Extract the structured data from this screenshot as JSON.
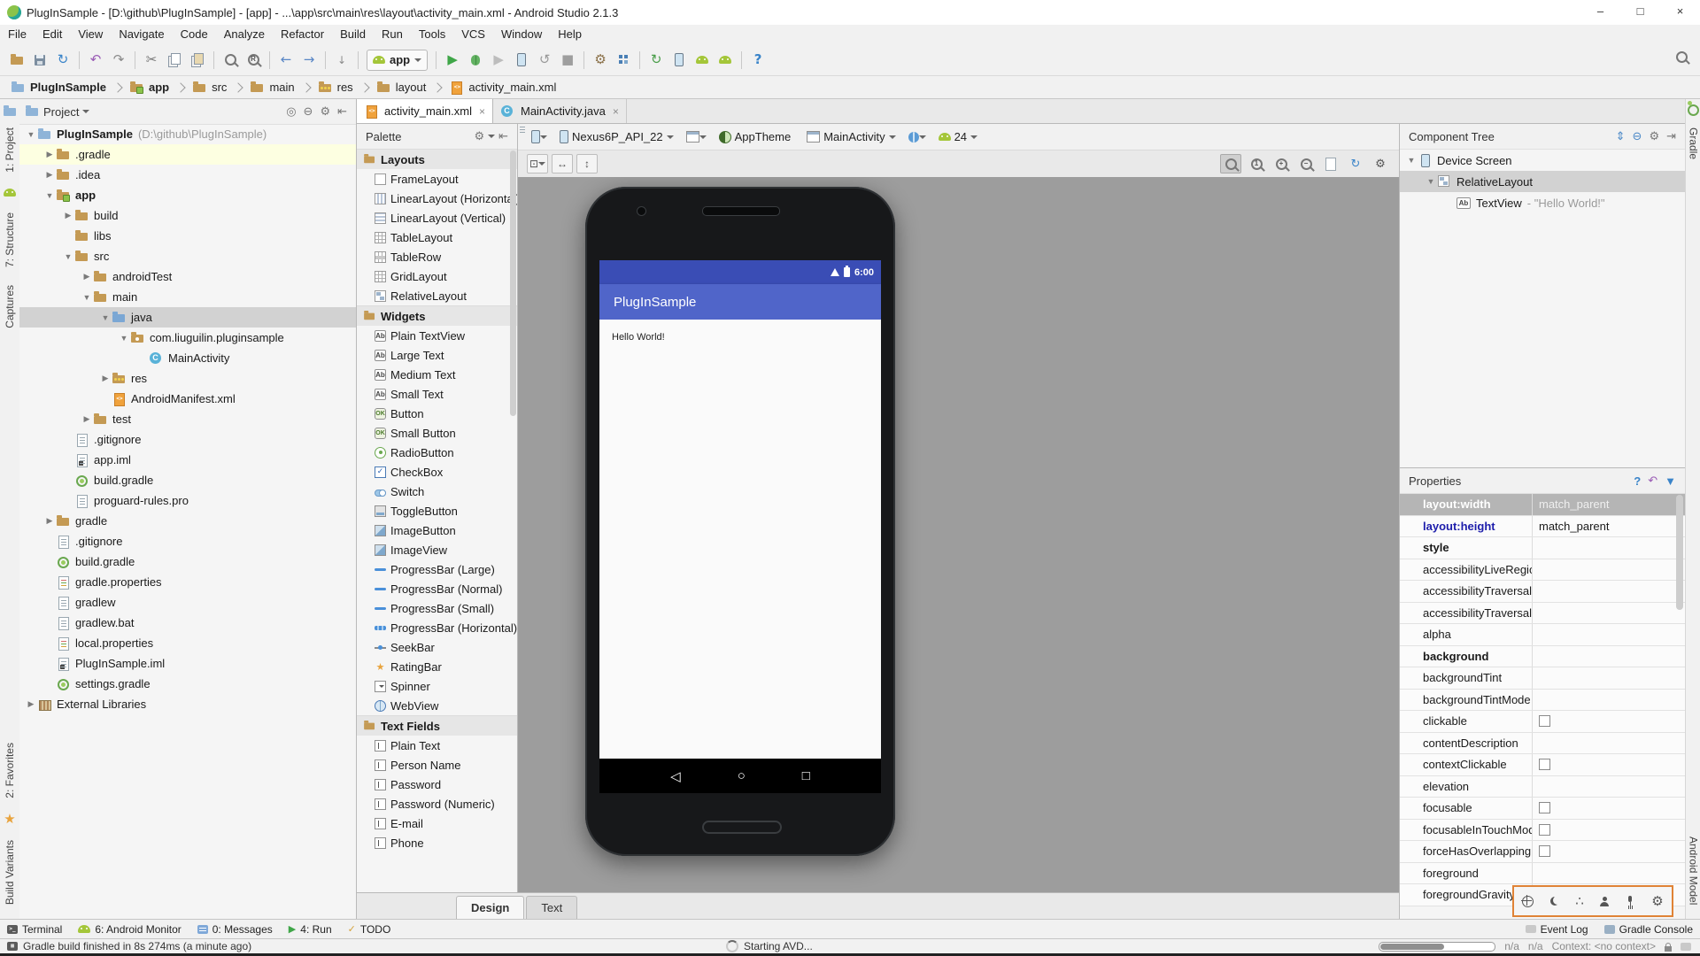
{
  "window": {
    "title": "PlugInSample - [D:\\github\\PlugInSample] - [app] - ...\\app\\src\\main\\res\\layout\\activity_main.xml - Android Studio 2.1.3",
    "controls": [
      "minimize",
      "maximize",
      "close"
    ]
  },
  "menubar": {
    "items": [
      "File",
      "Edit",
      "View",
      "Navigate",
      "Code",
      "Analyze",
      "Refactor",
      "Build",
      "Run",
      "Tools",
      "VCS",
      "Window",
      "Help"
    ]
  },
  "toolbar": {
    "run_config": "app",
    "groups": [
      [
        "open",
        "save",
        "sync"
      ],
      [
        "undo",
        "redo"
      ],
      [
        "cut",
        "copy",
        "paste"
      ],
      [
        "find",
        "replace"
      ],
      [
        "back",
        "forward"
      ],
      [
        "line-ops"
      ],
      [
        "run-config"
      ],
      [
        "run",
        "debug",
        "coverage",
        "attach-debugger",
        "restart",
        "stop"
      ],
      [
        "settings",
        "structure"
      ],
      [
        "gradle-sync",
        "avd-manager",
        "sdk-manager",
        "device-monitor"
      ],
      [
        "help"
      ]
    ]
  },
  "breadcrumbs": {
    "items": [
      {
        "label": "PlugInSample",
        "icon": "project",
        "bold": true
      },
      {
        "label": "app",
        "icon": "module",
        "bold": true
      },
      {
        "label": "src",
        "icon": "folder"
      },
      {
        "label": "main",
        "icon": "folder"
      },
      {
        "label": "res",
        "icon": "res"
      },
      {
        "label": "layout",
        "icon": "folder"
      },
      {
        "label": "activity_main.xml",
        "icon": "xml"
      }
    ]
  },
  "left_strip": {
    "top": [
      "1: Project",
      "7: Structure",
      "Captures"
    ],
    "bottom": [
      "2: Favorites",
      "Build Variants"
    ]
  },
  "right_strip": {
    "top": [
      "Gradle"
    ],
    "bottom": [
      "Android Model"
    ]
  },
  "project": {
    "title": "Project",
    "tree": [
      {
        "d": 0,
        "icon": "project",
        "label": "PlugInSample",
        "note": "(D:\\github\\PlugInSample)",
        "bold": true,
        "arrow": "down"
      },
      {
        "d": 1,
        "icon": "folder",
        "label": ".gradle",
        "arrow": "right",
        "highlight": true
      },
      {
        "d": 1,
        "icon": "folder",
        "label": ".idea",
        "arrow": "right"
      },
      {
        "d": 1,
        "icon": "module",
        "label": "app",
        "bold": true,
        "arrow": "down"
      },
      {
        "d": 2,
        "icon": "folder",
        "label": "build",
        "arrow": "right"
      },
      {
        "d": 2,
        "icon": "folder",
        "label": "libs"
      },
      {
        "d": 2,
        "icon": "folder",
        "label": "src",
        "arrow": "down"
      },
      {
        "d": 3,
        "icon": "folder",
        "label": "androidTest",
        "arrow": "right"
      },
      {
        "d": 3,
        "icon": "folder",
        "label": "main",
        "arrow": "down"
      },
      {
        "d": 4,
        "icon": "folder-blue",
        "label": "java",
        "arrow": "down",
        "selected": true
      },
      {
        "d": 5,
        "icon": "package",
        "label": "com.liuguilin.pluginsample",
        "arrow": "down"
      },
      {
        "d": 6,
        "icon": "class",
        "label": "MainActivity"
      },
      {
        "d": 4,
        "icon": "res",
        "label": "res",
        "arrow": "right"
      },
      {
        "d": 4,
        "icon": "xml",
        "label": "AndroidManifest.xml"
      },
      {
        "d": 3,
        "icon": "folder",
        "label": "test",
        "arrow": "right"
      },
      {
        "d": 2,
        "icon": "file",
        "label": ".gitignore"
      },
      {
        "d": 2,
        "icon": "iml",
        "label": "app.iml"
      },
      {
        "d": 2,
        "icon": "gradle",
        "label": "build.gradle"
      },
      {
        "d": 2,
        "icon": "file",
        "label": "proguard-rules.pro"
      },
      {
        "d": 1,
        "icon": "folder",
        "label": "gradle",
        "arrow": "right"
      },
      {
        "d": 1,
        "icon": "file",
        "label": ".gitignore"
      },
      {
        "d": 1,
        "icon": "gradle",
        "label": "build.gradle"
      },
      {
        "d": 1,
        "icon": "props",
        "label": "gradle.properties"
      },
      {
        "d": 1,
        "icon": "file",
        "label": "gradlew"
      },
      {
        "d": 1,
        "icon": "file",
        "label": "gradlew.bat"
      },
      {
        "d": 1,
        "icon": "props",
        "label": "local.properties"
      },
      {
        "d": 1,
        "icon": "iml",
        "label": "PlugInSample.iml"
      },
      {
        "d": 1,
        "icon": "gradle",
        "label": "settings.gradle"
      },
      {
        "d": 0,
        "icon": "lib",
        "label": "External Libraries",
        "arrow": "right"
      }
    ]
  },
  "editor": {
    "tabs": [
      {
        "label": "activity_main.xml",
        "icon": "xml",
        "active": true
      },
      {
        "label": "MainActivity.java",
        "icon": "class",
        "active": false
      }
    ],
    "config": {
      "device": "Nexus6P_API_22",
      "theme": "AppTheme",
      "activity": "MainActivity",
      "api": "24"
    },
    "bottom_tabs": [
      {
        "label": "Design",
        "active": true
      },
      {
        "label": "Text",
        "active": false
      }
    ]
  },
  "palette": {
    "title": "Palette",
    "sections": [
      {
        "title": "Layouts",
        "items": [
          {
            "label": "FrameLayout",
            "icon": "frame"
          },
          {
            "label": "LinearLayout (Horizontal)",
            "icon": "linear-h"
          },
          {
            "label": "LinearLayout (Vertical)",
            "icon": "linear-v"
          },
          {
            "label": "TableLayout",
            "icon": "table"
          },
          {
            "label": "TableRow",
            "icon": "table-row"
          },
          {
            "label": "GridLayout",
            "icon": "grid"
          },
          {
            "label": "RelativeLayout",
            "icon": "relative"
          }
        ]
      },
      {
        "title": "Widgets",
        "items": [
          {
            "label": "Plain TextView",
            "icon": "ab"
          },
          {
            "label": "Large Text",
            "icon": "ab"
          },
          {
            "label": "Medium Text",
            "icon": "ab"
          },
          {
            "label": "Small Text",
            "icon": "ab"
          },
          {
            "label": "Button",
            "icon": "btn"
          },
          {
            "label": "Small Button",
            "icon": "btn"
          },
          {
            "label": "RadioButton",
            "icon": "radio"
          },
          {
            "label": "CheckBox",
            "icon": "check"
          },
          {
            "label": "Switch",
            "icon": "switch"
          },
          {
            "label": "ToggleButton",
            "icon": "toggle"
          },
          {
            "label": "ImageButton",
            "icon": "image"
          },
          {
            "label": "ImageView",
            "icon": "image"
          },
          {
            "label": "ProgressBar (Large)",
            "icon": "progress"
          },
          {
            "label": "ProgressBar (Normal)",
            "icon": "progress"
          },
          {
            "label": "ProgressBar (Small)",
            "icon": "progress"
          },
          {
            "label": "ProgressBar (Horizontal)",
            "icon": "progress-h"
          },
          {
            "label": "SeekBar",
            "icon": "seek"
          },
          {
            "label": "RatingBar",
            "icon": "rating"
          },
          {
            "label": "Spinner",
            "icon": "spinner"
          },
          {
            "label": "WebView",
            "icon": "web"
          }
        ]
      },
      {
        "title": "Text Fields",
        "items": [
          {
            "label": "Plain Text",
            "icon": "field"
          },
          {
            "label": "Person Name",
            "icon": "field"
          },
          {
            "label": "Password",
            "icon": "field"
          },
          {
            "label": "Password (Numeric)",
            "icon": "field"
          },
          {
            "label": "E-mail",
            "icon": "field"
          },
          {
            "label": "Phone",
            "icon": "field"
          }
        ]
      }
    ]
  },
  "preview": {
    "app_title": "PlugInSample",
    "content_text": "Hello World!",
    "status_time": "6:00",
    "colors": {
      "status_bar": "#3a4db5",
      "app_bar": "#5065c9",
      "content": "#fafafa",
      "nav_bar": "#000000"
    }
  },
  "component_tree": {
    "title": "Component Tree",
    "nodes": [
      {
        "label": "Device Screen",
        "icon": "device",
        "d": 0,
        "arrow": "down"
      },
      {
        "label": "RelativeLayout",
        "icon": "relative",
        "d": 1,
        "arrow": "down",
        "selected": true
      },
      {
        "label": "TextView",
        "suffix": " - \"Hello World!\"",
        "icon": "ab",
        "d": 2
      }
    ]
  },
  "properties": {
    "title": "Properties",
    "rows": [
      {
        "name": "layout:width",
        "value": "match_parent",
        "selected": true
      },
      {
        "name": "layout:height",
        "value": "match_parent",
        "style": "blue"
      },
      {
        "name": "style",
        "style": "bold"
      },
      {
        "name": "accessibilityLiveRegion"
      },
      {
        "name": "accessibilityTraversalAfter"
      },
      {
        "name": "accessibilityTraversalBefore"
      },
      {
        "name": "alpha"
      },
      {
        "name": "background",
        "style": "bold"
      },
      {
        "name": "backgroundTint"
      },
      {
        "name": "backgroundTintMode"
      },
      {
        "name": "clickable",
        "checkbox": true
      },
      {
        "name": "contentDescription"
      },
      {
        "name": "contextClickable",
        "checkbox": true
      },
      {
        "name": "elevation"
      },
      {
        "name": "focusable",
        "checkbox": true
      },
      {
        "name": "focusableInTouchMode",
        "checkbox": true
      },
      {
        "name": "forceHasOverlappingRendering",
        "checkbox": true
      },
      {
        "name": "foreground"
      },
      {
        "name": "foregroundGravity",
        "value": "[]"
      }
    ]
  },
  "dock": {
    "left": [
      {
        "label": "Terminal",
        "icon": "terminal"
      },
      {
        "label": "6: Android Monitor",
        "icon": "android"
      },
      {
        "label": "0: Messages",
        "icon": "messages"
      },
      {
        "label": "4: Run",
        "icon": "run"
      },
      {
        "label": "TODO",
        "icon": "todo"
      }
    ],
    "right": [
      {
        "label": "Event Log",
        "icon": "balloon"
      },
      {
        "label": "Gradle Console",
        "icon": "console"
      }
    ]
  },
  "float_tools": {
    "icons": [
      "crosshair",
      "moon",
      "dots",
      "person",
      "mic",
      "wrench"
    ]
  },
  "status_bar": {
    "message": "Gradle build finished in 8s 274ms (a minute ago)",
    "center": "Starting AVD...",
    "na1": "n/a",
    "na2": "n/a",
    "context": "Context: <no context>"
  }
}
